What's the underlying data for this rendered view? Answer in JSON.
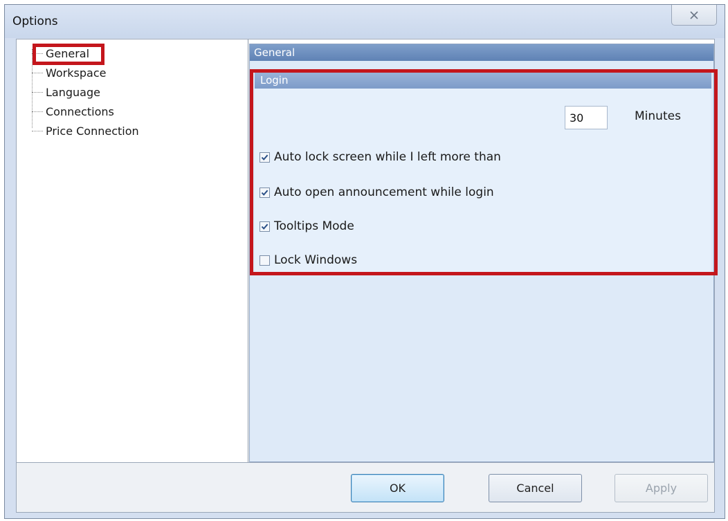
{
  "window": {
    "title": "Options"
  },
  "nav_tree": {
    "items": [
      {
        "label": "General",
        "selected": true
      },
      {
        "label": "Workspace",
        "selected": false
      },
      {
        "label": "Language",
        "selected": false
      },
      {
        "label": "Connections",
        "selected": false
      },
      {
        "label": "Price Connection",
        "selected": false
      }
    ]
  },
  "panel": {
    "header": "General",
    "group": {
      "title": "Login",
      "options": [
        {
          "label": "Auto lock screen while I left more than",
          "checked": true
        },
        {
          "label": "Auto open announcement while login",
          "checked": true
        },
        {
          "label": "Tooltips Mode",
          "checked": true
        },
        {
          "label": "Lock Windows",
          "checked": false
        }
      ],
      "lock_minutes_value": "30",
      "lock_minutes_unit": "Minutes"
    }
  },
  "buttons": {
    "ok": "OK",
    "cancel": "Cancel",
    "apply": "Apply"
  },
  "colors": {
    "highlight": "#c4161c",
    "header": "#6f90c0",
    "pane": "#deeaf8"
  }
}
